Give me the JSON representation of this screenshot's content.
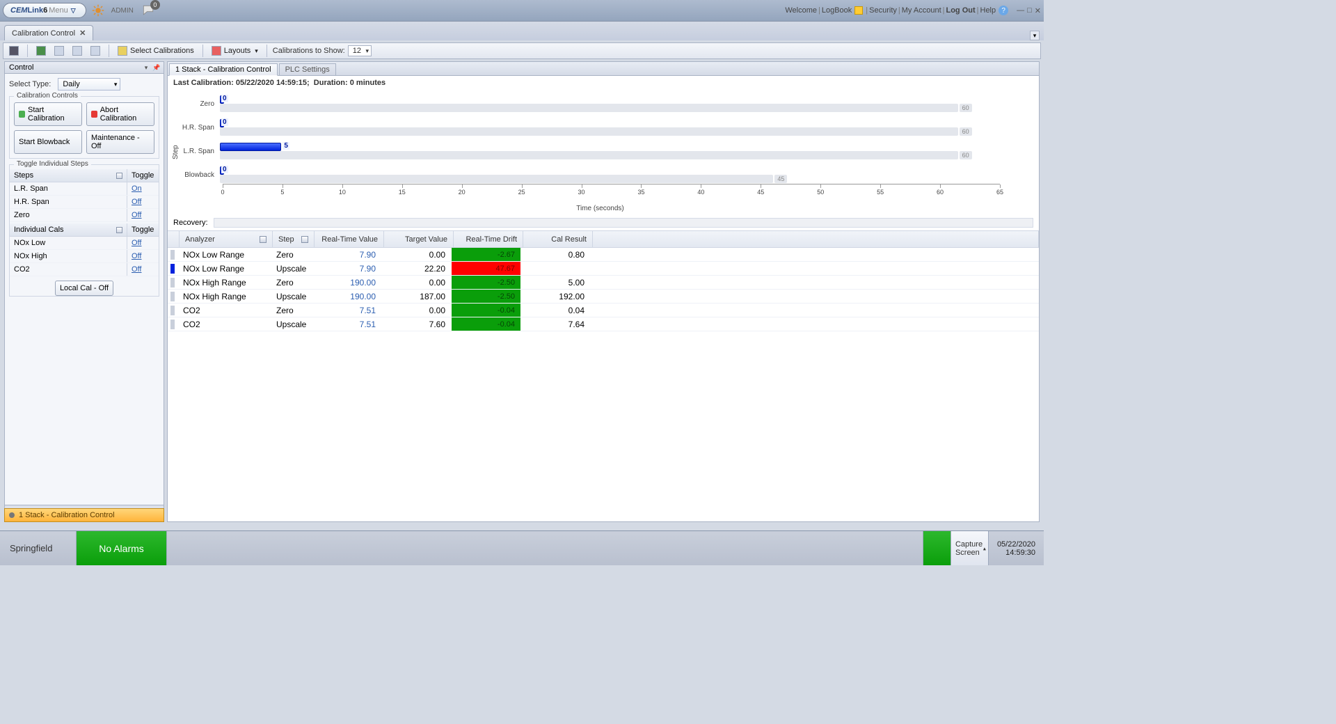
{
  "header": {
    "logo_prefix": "CEM",
    "logo_mid": "Link",
    "logo_six": "6",
    "logo_menu": "Menu",
    "admin": "ADMIN",
    "chat_badge": "0",
    "welcome": "Welcome",
    "logbook": "LogBook",
    "security": "Security",
    "my_account": "My Account",
    "logout": "Log Out",
    "help": "Help"
  },
  "tab": {
    "title": "Calibration Control"
  },
  "toolbar": {
    "select_calibrations": "Select Calibrations",
    "layouts": "Layouts",
    "cal_show_label": "Calibrations to Show:",
    "cal_show_value": "12"
  },
  "side": {
    "title": "Control",
    "select_type_label": "Select Type:",
    "select_type_value": "Daily",
    "group1_legend": "Calibration Controls",
    "start_cal": "Start Calibration",
    "abort_cal": "Abort Calibration",
    "start_blow": "Start Blowback",
    "maint_off": "Maintenance - Off",
    "group2_legend": "Toggle Individual Steps",
    "steps_head": "Steps",
    "toggle_head": "Toggle",
    "steps": [
      {
        "name": "L.R. Span",
        "toggle": "On"
      },
      {
        "name": "H.R. Span",
        "toggle": "Off"
      },
      {
        "name": "Zero",
        "toggle": "Off"
      }
    ],
    "ind_head": "Individual Cals",
    "inds": [
      {
        "name": "NOx Low",
        "toggle": "Off"
      },
      {
        "name": "NOx High",
        "toggle": "Off"
      },
      {
        "name": "CO2",
        "toggle": "Off"
      }
    ],
    "local_cal": "Local Cal - Off",
    "bottom_tab": "1 Stack  - Calibration Control"
  },
  "content": {
    "tab1": "1 Stack  - Calibration Control",
    "tab2": "PLC Settings",
    "last_cal_label": "Last Calibration:",
    "last_cal_value": "05/22/2020 14:59:15;",
    "duration_label": "Duration:",
    "duration_value": "0 minutes",
    "recovery_label": "Recovery:"
  },
  "chart_data": {
    "type": "bar",
    "ylabel": "Step",
    "xlabel": "Time (seconds)",
    "xlim": [
      0,
      65
    ],
    "xticks": [
      0,
      5,
      10,
      15,
      20,
      25,
      30,
      35,
      40,
      45,
      50,
      55,
      60,
      65
    ],
    "categories": [
      "Zero",
      "H.R. Span",
      "L.R. Span",
      "Blowback"
    ],
    "series": [
      {
        "name": "progress_top_blue",
        "values": [
          0,
          0,
          5,
          0
        ]
      },
      {
        "name": "track_bottom_grey_end",
        "values": [
          60,
          60,
          60,
          45
        ]
      }
    ],
    "top_labels": [
      "0",
      "0",
      "5",
      "0"
    ],
    "end_labels": [
      "60",
      "60",
      "60",
      "45"
    ]
  },
  "grid": {
    "cols": [
      "Analyzer",
      "Step",
      "Real-Time Value",
      "Target Value",
      "Real-Time Drift",
      "Cal Result"
    ],
    "rows": [
      {
        "marker": "grey",
        "analyzer": "NOx Low Range",
        "step": "Zero",
        "rtv": "7.90",
        "target": "0.00",
        "drift": "-2.67",
        "drift_state": "green",
        "result": "0.80"
      },
      {
        "marker": "blue",
        "analyzer": "NOx Low Range",
        "step": "Upscale",
        "rtv": "7.90",
        "target": "22.20",
        "drift": "47.67",
        "drift_state": "red",
        "result": ""
      },
      {
        "marker": "grey",
        "analyzer": "NOx High Range",
        "step": "Zero",
        "rtv": "190.00",
        "target": "0.00",
        "drift": "-2.50",
        "drift_state": "green",
        "result": "5.00"
      },
      {
        "marker": "grey",
        "analyzer": "NOx High Range",
        "step": "Upscale",
        "rtv": "190.00",
        "target": "187.00",
        "drift": "-2.50",
        "drift_state": "green",
        "result": "192.00"
      },
      {
        "marker": "grey",
        "analyzer": "CO2",
        "step": "Zero",
        "rtv": "7.51",
        "target": "0.00",
        "drift": "-0.04",
        "drift_state": "green",
        "result": "0.04"
      },
      {
        "marker": "grey",
        "analyzer": "CO2",
        "step": "Upscale",
        "rtv": "7.51",
        "target": "7.60",
        "drift": "-0.04",
        "drift_state": "green",
        "result": "7.64"
      }
    ]
  },
  "status": {
    "location": "Springfield",
    "alarm": "No Alarms",
    "capture1": "Capture",
    "capture2": "Screen",
    "date": "05/22/2020",
    "time": "14:59:30"
  }
}
